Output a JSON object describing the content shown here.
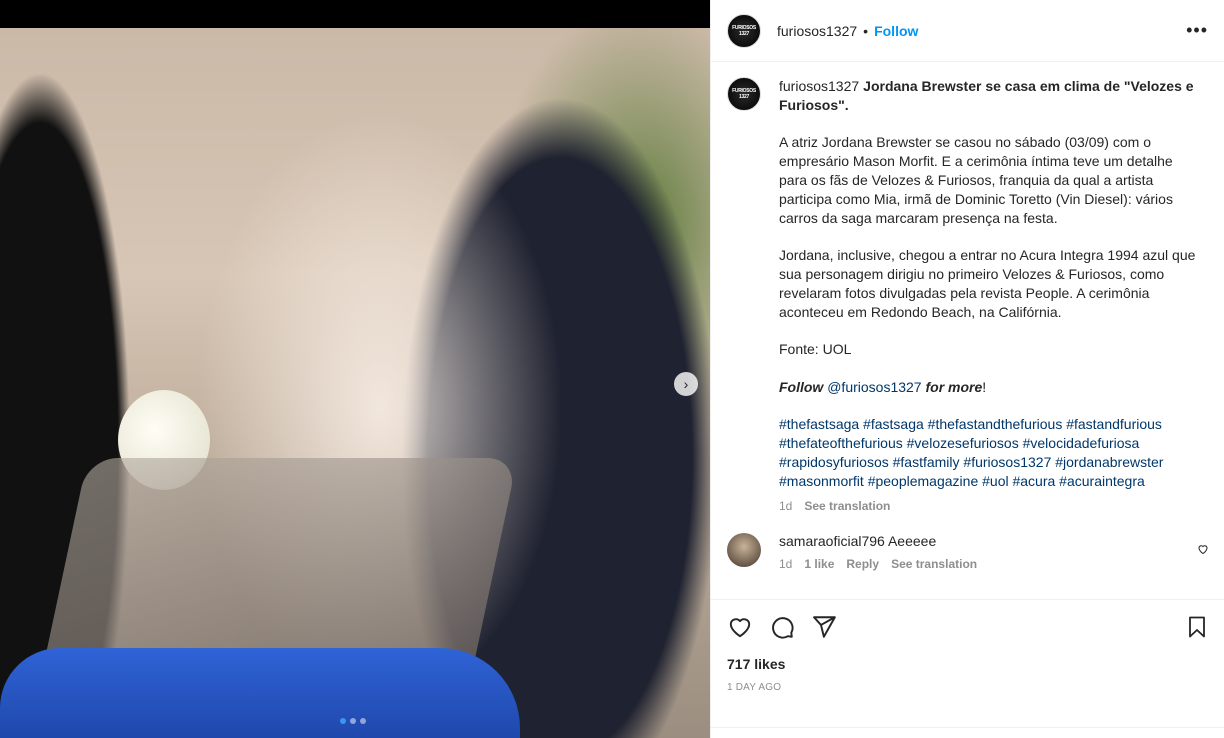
{
  "post": {
    "username": "furiosos1327",
    "avatar_text": "FURIOSOS 1327",
    "follow_label": "Follow",
    "separator": "•",
    "more_label": "•••"
  },
  "caption": {
    "username": "furiosos1327",
    "title": "Jordana Brewster se casa em clima de \"Velozes e Furiosos\".",
    "paragraph1": "A atriz Jordana Brewster se casou no sábado (03/09) com o empresário Mason Morfit. E a cerimônia íntima teve um detalhe para os fãs de Velozes & Furiosos, franquia da qual a artista participa como Mia, irmã de Dominic Toretto (Vin Diesel): vários carros da saga marcaram presença na festa.",
    "paragraph2": "Jordana, inclusive, chegou a entrar no Acura Integra 1994 azul que sua personagem dirigiu no primeiro Velozes & Furiosos, como revelaram fotos divulgadas pela revista People. A cerimônia aconteceu em Redondo Beach, na Califórnia.",
    "source": "Fonte: UOL",
    "follow_prefix": "Follow",
    "follow_handle": "@furiosos1327",
    "follow_suffix": "for more",
    "follow_end": "!",
    "hashtags": "#thefastsaga #fastsaga #thefastandthefurious #fastandfurious #thefateofthefurious #velozesefuriosos #velocidadefuriosa #rapidosyfuriosos #fastfamily #furiosos1327 #jordanabrewster #masonmorfit #peoplemagazine #uol #acura #acuraintegra",
    "age": "1d",
    "see_translation": "See translation"
  },
  "comment": {
    "username": "samaraoficial796",
    "text": "Aeeeee",
    "age": "1d",
    "likes": "1 like",
    "reply": "Reply",
    "see_translation": "See translation"
  },
  "actions": {
    "likes": "717 likes",
    "time": "1 DAY AGO"
  },
  "media": {
    "carousel_index": 1,
    "carousel_count": 3,
    "next_glyph": "›"
  }
}
